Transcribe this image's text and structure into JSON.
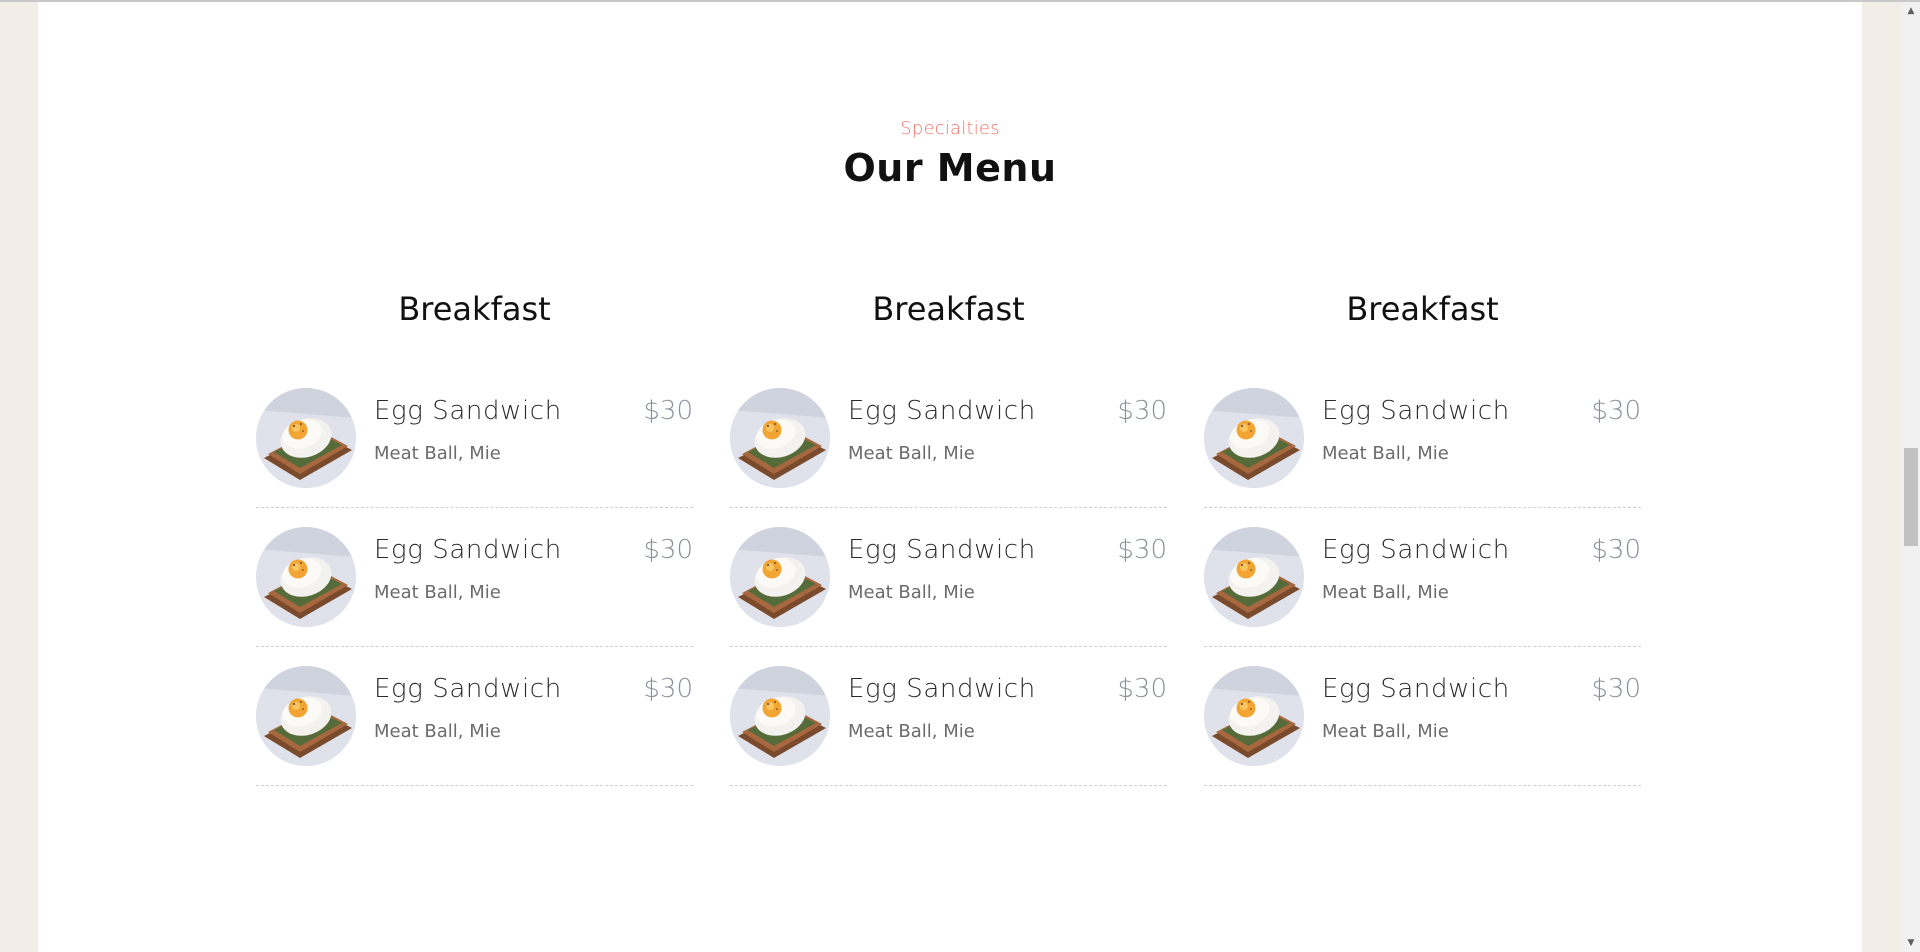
{
  "section": {
    "subtitle": "Specialties",
    "title": "Our Menu"
  },
  "columns": [
    {
      "title": "Breakfast",
      "items": [
        {
          "name": "Egg Sandwich",
          "price": "$30",
          "desc": "Meat Ball, Mie"
        },
        {
          "name": "Egg Sandwich",
          "price": "$30",
          "desc": "Meat Ball, Mie"
        },
        {
          "name": "Egg Sandwich",
          "price": "$30",
          "desc": "Meat Ball, Mie"
        }
      ]
    },
    {
      "title": "Breakfast",
      "items": [
        {
          "name": "Egg Sandwich",
          "price": "$30",
          "desc": "Meat Ball, Mie"
        },
        {
          "name": "Egg Sandwich",
          "price": "$30",
          "desc": "Meat Ball, Mie"
        },
        {
          "name": "Egg Sandwich",
          "price": "$30",
          "desc": "Meat Ball, Mie"
        }
      ]
    },
    {
      "title": "Breakfast",
      "items": [
        {
          "name": "Egg Sandwich",
          "price": "$30",
          "desc": "Meat Ball, Mie"
        },
        {
          "name": "Egg Sandwich",
          "price": "$30",
          "desc": "Meat Ball, Mie"
        },
        {
          "name": "Egg Sandwich",
          "price": "$30",
          "desc": "Meat Ball, Mie"
        }
      ]
    }
  ],
  "colors": {
    "accent": "#f2736a",
    "page_bg": "#ffffff",
    "outer_bg": "#f3ede8",
    "price": "#8a8f99"
  },
  "icons": {
    "item_image": "egg-sandwich-photo",
    "scroll_up": "chevron-up-icon",
    "scroll_down": "chevron-down-icon"
  }
}
